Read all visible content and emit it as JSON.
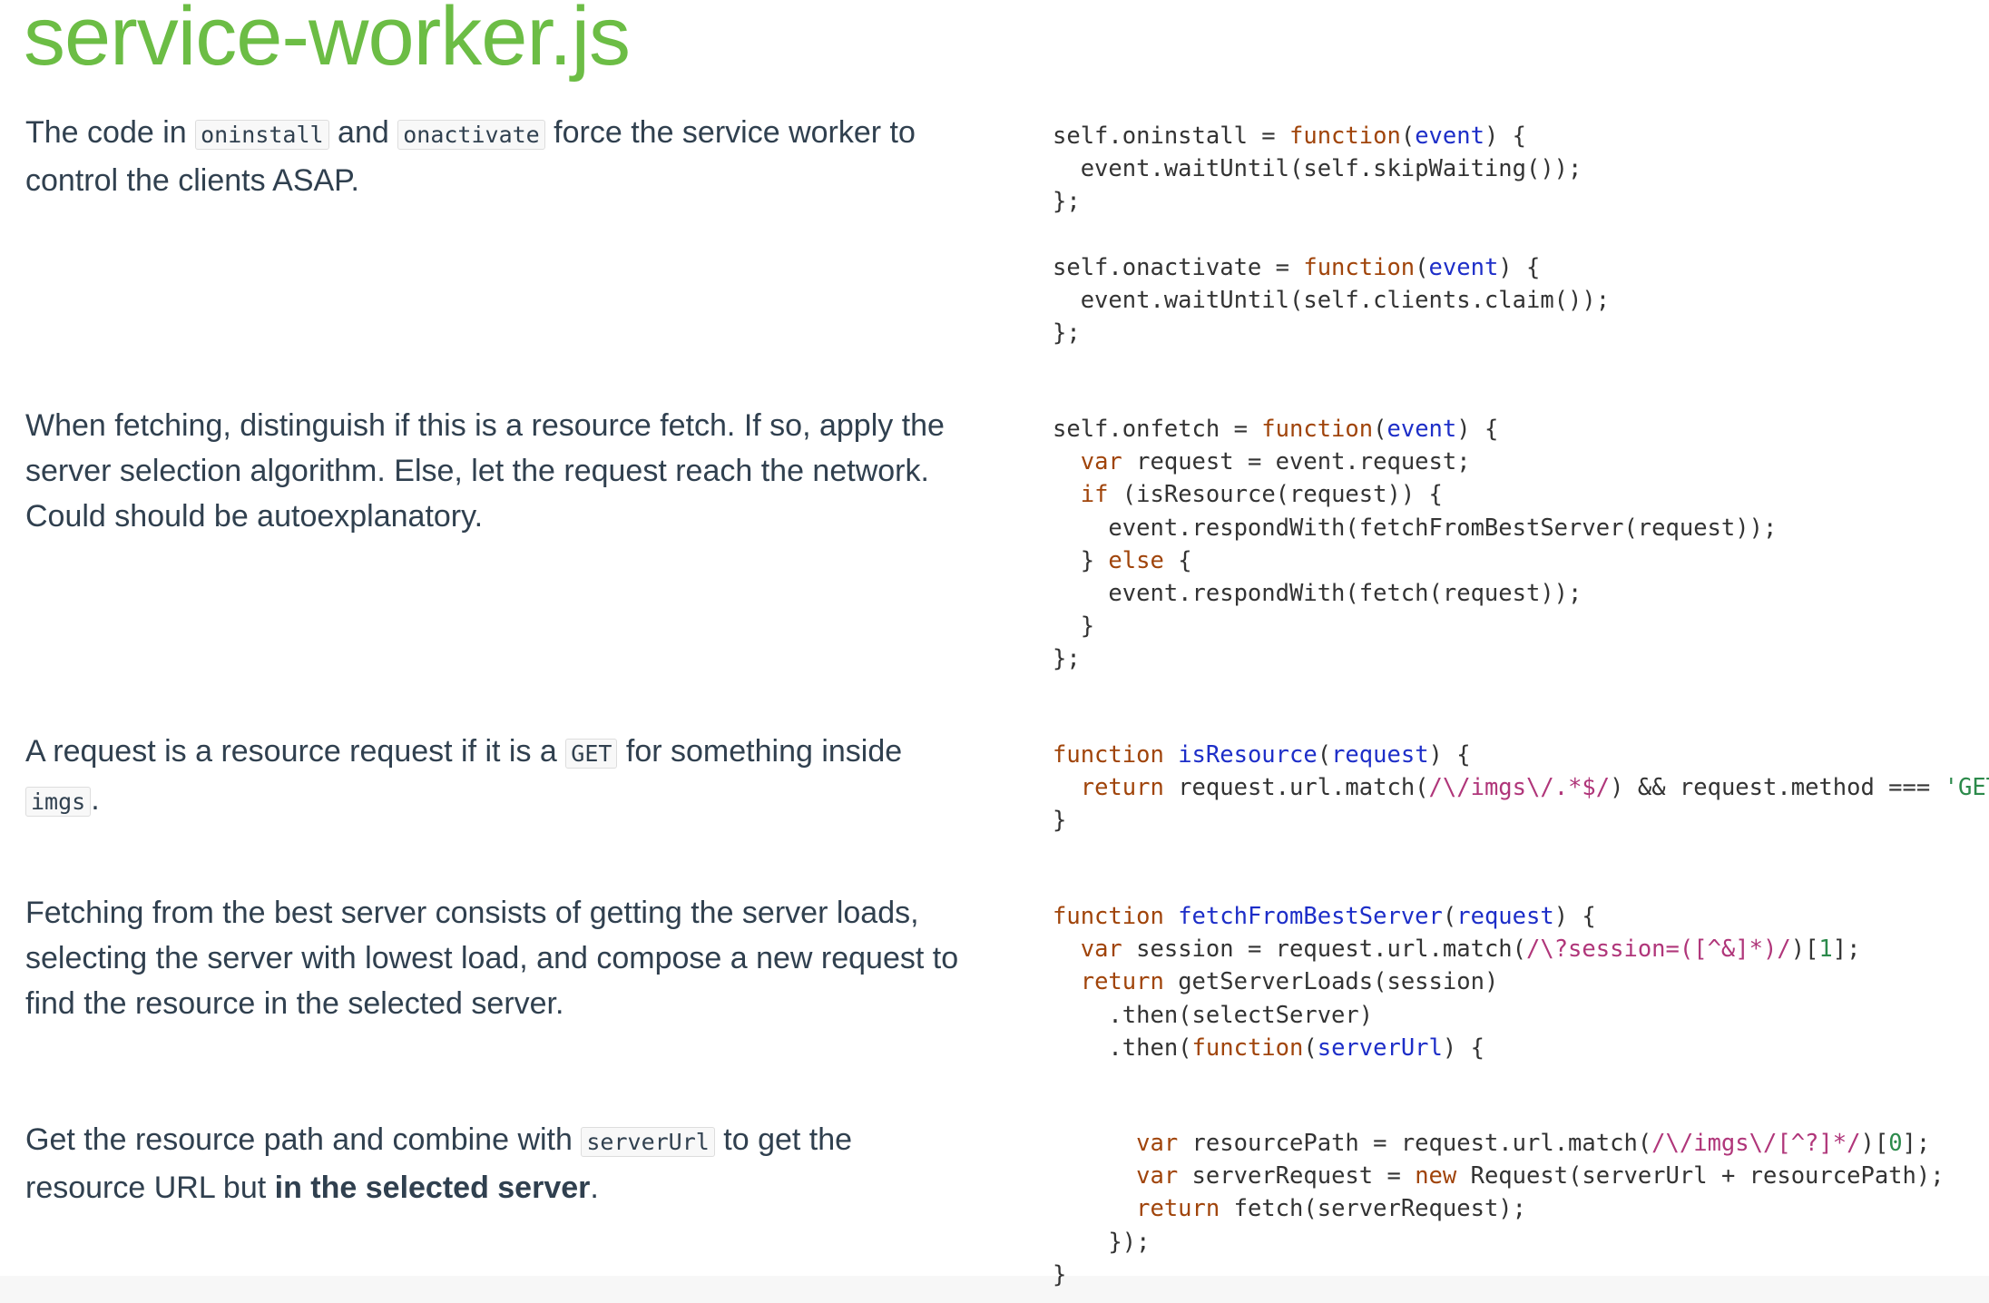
{
  "title": "service-worker.js",
  "sections": [
    {
      "prose": [
        {
          "t": "text",
          "v": "The code in "
        },
        {
          "t": "code",
          "v": "oninstall"
        },
        {
          "t": "text",
          "v": " and "
        },
        {
          "t": "code",
          "v": "onactivate"
        },
        {
          "t": "text",
          "v": " force the service worker to control the clients ASAP."
        }
      ],
      "code": [
        [
          [
            "p",
            "self.oninstall = "
          ],
          [
            "k",
            "function"
          ],
          [
            "p",
            "("
          ],
          [
            "a",
            "event"
          ],
          [
            "p",
            ") {"
          ]
        ],
        [
          [
            "p",
            "  event.waitUntil(self.skipWaiting());"
          ]
        ],
        [
          [
            "p",
            "};"
          ]
        ],
        [],
        [
          [
            "p",
            "self.onactivate = "
          ],
          [
            "k",
            "function"
          ],
          [
            "p",
            "("
          ],
          [
            "a",
            "event"
          ],
          [
            "p",
            ") {"
          ]
        ],
        [
          [
            "p",
            "  event.waitUntil(self.clients.claim());"
          ]
        ],
        [
          [
            "p",
            "};"
          ]
        ]
      ]
    },
    {
      "prose": [
        {
          "t": "text",
          "v": "When fetching, distinguish if this is a resource fetch. If so, apply the server selection algorithm. Else, let the request reach the network. Could should be autoexplanatory."
        }
      ],
      "code": [
        [
          [
            "p",
            "self.onfetch = "
          ],
          [
            "k",
            "function"
          ],
          [
            "p",
            "("
          ],
          [
            "a",
            "event"
          ],
          [
            "p",
            ") {"
          ]
        ],
        [
          [
            "p",
            "  "
          ],
          [
            "k",
            "var"
          ],
          [
            "p",
            " request = event.request;"
          ]
        ],
        [
          [
            "p",
            "  "
          ],
          [
            "k",
            "if"
          ],
          [
            "p",
            " (isResource(request)) {"
          ]
        ],
        [
          [
            "p",
            "    event.respondWith(fetchFromBestServer(request));"
          ]
        ],
        [
          [
            "p",
            "  } "
          ],
          [
            "k",
            "else"
          ],
          [
            "p",
            " {"
          ]
        ],
        [
          [
            "p",
            "    event.respondWith(fetch(request));"
          ]
        ],
        [
          [
            "p",
            "  }"
          ]
        ],
        [
          [
            "p",
            "};"
          ]
        ]
      ]
    },
    {
      "prose": [
        {
          "t": "text",
          "v": "A request is a resource request if it is a "
        },
        {
          "t": "code",
          "v": "GET"
        },
        {
          "t": "text",
          "v": " for something inside "
        },
        {
          "t": "code",
          "v": "imgs"
        },
        {
          "t": "text",
          "v": "."
        }
      ],
      "code": [
        [
          [
            "k",
            "function"
          ],
          [
            "p",
            " "
          ],
          [
            "a",
            "isResource"
          ],
          [
            "p",
            "("
          ],
          [
            "a",
            "request"
          ],
          [
            "p",
            ") {"
          ]
        ],
        [
          [
            "p",
            "  "
          ],
          [
            "k",
            "return"
          ],
          [
            "p",
            " request.url.match("
          ],
          [
            "r",
            "/\\/imgs\\/.*$/"
          ],
          [
            "p",
            ") && request.method === "
          ],
          [
            "s",
            "'GET'"
          ],
          [
            "p",
            ";"
          ]
        ],
        [
          [
            "p",
            "}"
          ]
        ]
      ]
    },
    {
      "prose": [
        {
          "t": "text",
          "v": "Fetching from the best server consists of getting the server loads, selecting the server with lowest load, and compose a new request to find the resource in the selected server."
        }
      ],
      "code": [
        [
          [
            "k",
            "function"
          ],
          [
            "p",
            " "
          ],
          [
            "a",
            "fetchFromBestServer"
          ],
          [
            "p",
            "("
          ],
          [
            "a",
            "request"
          ],
          [
            "p",
            ") {"
          ]
        ],
        [
          [
            "p",
            "  "
          ],
          [
            "k",
            "var"
          ],
          [
            "p",
            " session = request.url.match("
          ],
          [
            "r",
            "/\\?session=([^&]*)/"
          ],
          [
            "p",
            ")["
          ],
          [
            "n",
            "1"
          ],
          [
            "p",
            "];"
          ]
        ],
        [
          [
            "p",
            "  "
          ],
          [
            "k",
            "return"
          ],
          [
            "p",
            " getServerLoads(session)"
          ]
        ],
        [
          [
            "p",
            "    .then(selectServer)"
          ]
        ],
        [
          [
            "p",
            "    .then("
          ],
          [
            "k",
            "function"
          ],
          [
            "p",
            "("
          ],
          [
            "a",
            "serverUrl"
          ],
          [
            "p",
            ") {"
          ]
        ]
      ]
    },
    {
      "prose": [
        {
          "t": "text",
          "v": "Get the resource path and combine with "
        },
        {
          "t": "code",
          "v": "serverUrl"
        },
        {
          "t": "text",
          "v": " to get the resource URL but "
        },
        {
          "t": "bold",
          "v": "in the selected server"
        },
        {
          "t": "text",
          "v": "."
        }
      ],
      "code": [
        [
          [
            "p",
            "      "
          ],
          [
            "k",
            "var"
          ],
          [
            "p",
            " resourcePath = request.url.match("
          ],
          [
            "r",
            "/\\/imgs\\/[^?]*/"
          ],
          [
            "p",
            ")["
          ],
          [
            "n",
            "0"
          ],
          [
            "p",
            "];"
          ]
        ],
        [
          [
            "p",
            "      "
          ],
          [
            "k",
            "var"
          ],
          [
            "p",
            " serverRequest = "
          ],
          [
            "k",
            "new"
          ],
          [
            "p",
            " Request(serverUrl + resourcePath);"
          ]
        ],
        [
          [
            "p",
            "      "
          ],
          [
            "k",
            "return"
          ],
          [
            "p",
            " fetch(serverRequest);"
          ]
        ],
        [
          [
            "p",
            "    });"
          ]
        ],
        [
          [
            "p",
            "}"
          ]
        ]
      ]
    }
  ]
}
